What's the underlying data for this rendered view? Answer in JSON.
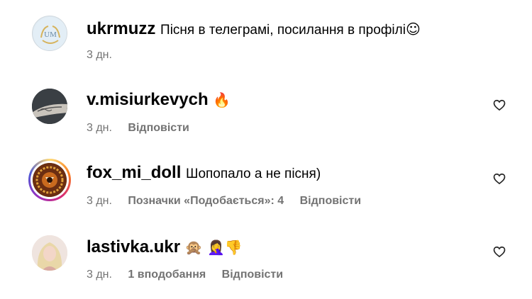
{
  "comments": [
    {
      "username": "ukrmuzz",
      "text": "Пісня в телеграмі, посилання в профілі",
      "emoji": "☺",
      "time": "3 дн.",
      "likes": "",
      "reply": "",
      "avatar_text": "UM"
    },
    {
      "username": "v.misiurkevych",
      "text": "",
      "emoji": "🔥",
      "time": "3 дн.",
      "likes": "",
      "reply": "Відповісти"
    },
    {
      "username": "fox_mi_doll",
      "text": "Шопопало а не пісня)",
      "emoji": "",
      "time": "3 дн.",
      "likes": "Позначки «Подобається»: 4",
      "reply": "Відповісти"
    },
    {
      "username": "lastivka.ukr",
      "text": "",
      "emoji": "🙊 🤦‍♀️👎",
      "time": "3 дн.",
      "likes": "1 вподобання",
      "reply": "Відповісти"
    }
  ],
  "colors": {
    "meta_text": "#737373",
    "story_ring": [
      "#feda75",
      "#d62976",
      "#962fbf"
    ]
  },
  "icons": {
    "like": "heart-outline-icon"
  }
}
